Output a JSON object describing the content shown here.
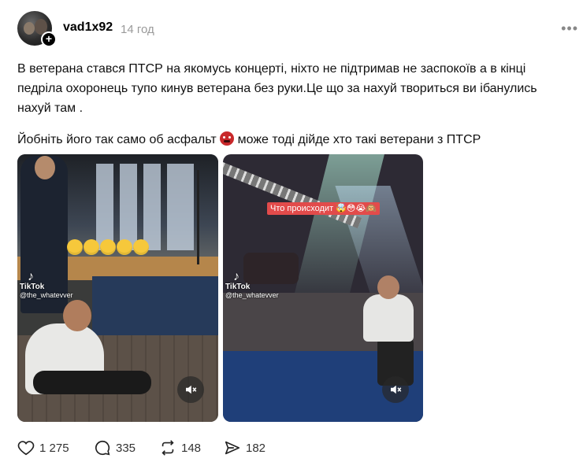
{
  "post": {
    "username": "vad1x92",
    "time": "14 год",
    "text_line1": "В ветерана стався ПТСР на якомусь концерті, ніхто не підтримав не заспокоїв а в кінці педріла охоронець тупо кинув ветерана без руки.Це що за нахуй твориться ви ібанулись нахуй там .",
    "text_line2_before": "Йобніть його так само об асфальт",
    "text_line2_after": "може тоді дійде хто такі ветерани з ПТСР"
  },
  "media": [
    {
      "tiktok_label": "TikTok",
      "handle": "@the_whatevver"
    },
    {
      "tiktok_label": "TikTok",
      "handle": "@the_whatevver",
      "overlay_text": "Что происходит 🤯😳😭🙉"
    }
  ],
  "actions": {
    "likes": "1 275",
    "comments": "335",
    "reposts": "148",
    "shares": "182"
  },
  "icons": {
    "like": "heart-icon",
    "comment": "comment-bubble-icon",
    "repost": "repost-icon",
    "share": "send-icon",
    "more": "more-icon",
    "mute": "muted-speaker-icon",
    "follow": "plus-icon"
  }
}
